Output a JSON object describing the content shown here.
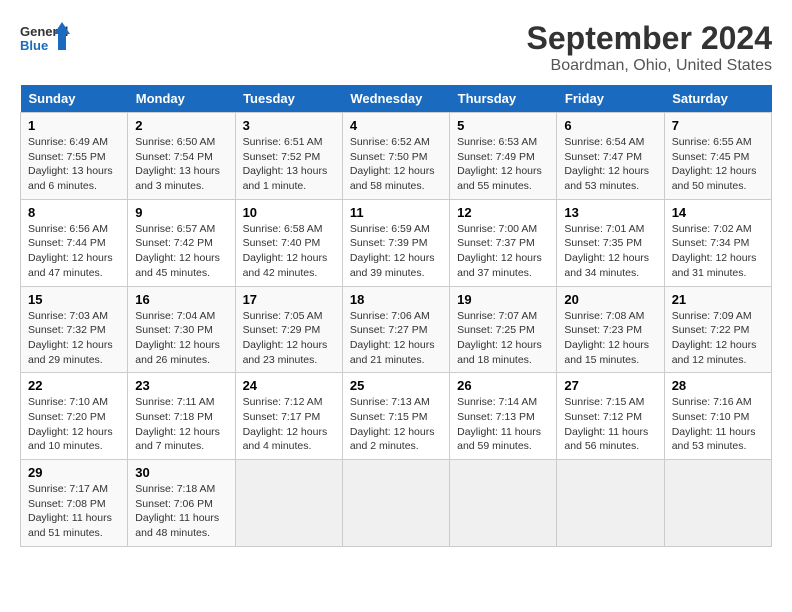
{
  "logo": {
    "line1": "General",
    "line2": "Blue"
  },
  "title": "September 2024",
  "subtitle": "Boardman, Ohio, United States",
  "header_days": [
    "Sunday",
    "Monday",
    "Tuesday",
    "Wednesday",
    "Thursday",
    "Friday",
    "Saturday"
  ],
  "weeks": [
    [
      {
        "day": "1",
        "info": "Sunrise: 6:49 AM\nSunset: 7:55 PM\nDaylight: 13 hours\nand 6 minutes."
      },
      {
        "day": "2",
        "info": "Sunrise: 6:50 AM\nSunset: 7:54 PM\nDaylight: 13 hours\nand 3 minutes."
      },
      {
        "day": "3",
        "info": "Sunrise: 6:51 AM\nSunset: 7:52 PM\nDaylight: 13 hours\nand 1 minute."
      },
      {
        "day": "4",
        "info": "Sunrise: 6:52 AM\nSunset: 7:50 PM\nDaylight: 12 hours\nand 58 minutes."
      },
      {
        "day": "5",
        "info": "Sunrise: 6:53 AM\nSunset: 7:49 PM\nDaylight: 12 hours\nand 55 minutes."
      },
      {
        "day": "6",
        "info": "Sunrise: 6:54 AM\nSunset: 7:47 PM\nDaylight: 12 hours\nand 53 minutes."
      },
      {
        "day": "7",
        "info": "Sunrise: 6:55 AM\nSunset: 7:45 PM\nDaylight: 12 hours\nand 50 minutes."
      }
    ],
    [
      {
        "day": "8",
        "info": "Sunrise: 6:56 AM\nSunset: 7:44 PM\nDaylight: 12 hours\nand 47 minutes."
      },
      {
        "day": "9",
        "info": "Sunrise: 6:57 AM\nSunset: 7:42 PM\nDaylight: 12 hours\nand 45 minutes."
      },
      {
        "day": "10",
        "info": "Sunrise: 6:58 AM\nSunset: 7:40 PM\nDaylight: 12 hours\nand 42 minutes."
      },
      {
        "day": "11",
        "info": "Sunrise: 6:59 AM\nSunset: 7:39 PM\nDaylight: 12 hours\nand 39 minutes."
      },
      {
        "day": "12",
        "info": "Sunrise: 7:00 AM\nSunset: 7:37 PM\nDaylight: 12 hours\nand 37 minutes."
      },
      {
        "day": "13",
        "info": "Sunrise: 7:01 AM\nSunset: 7:35 PM\nDaylight: 12 hours\nand 34 minutes."
      },
      {
        "day": "14",
        "info": "Sunrise: 7:02 AM\nSunset: 7:34 PM\nDaylight: 12 hours\nand 31 minutes."
      }
    ],
    [
      {
        "day": "15",
        "info": "Sunrise: 7:03 AM\nSunset: 7:32 PM\nDaylight: 12 hours\nand 29 minutes."
      },
      {
        "day": "16",
        "info": "Sunrise: 7:04 AM\nSunset: 7:30 PM\nDaylight: 12 hours\nand 26 minutes."
      },
      {
        "day": "17",
        "info": "Sunrise: 7:05 AM\nSunset: 7:29 PM\nDaylight: 12 hours\nand 23 minutes."
      },
      {
        "day": "18",
        "info": "Sunrise: 7:06 AM\nSunset: 7:27 PM\nDaylight: 12 hours\nand 21 minutes."
      },
      {
        "day": "19",
        "info": "Sunrise: 7:07 AM\nSunset: 7:25 PM\nDaylight: 12 hours\nand 18 minutes."
      },
      {
        "day": "20",
        "info": "Sunrise: 7:08 AM\nSunset: 7:23 PM\nDaylight: 12 hours\nand 15 minutes."
      },
      {
        "day": "21",
        "info": "Sunrise: 7:09 AM\nSunset: 7:22 PM\nDaylight: 12 hours\nand 12 minutes."
      }
    ],
    [
      {
        "day": "22",
        "info": "Sunrise: 7:10 AM\nSunset: 7:20 PM\nDaylight: 12 hours\nand 10 minutes."
      },
      {
        "day": "23",
        "info": "Sunrise: 7:11 AM\nSunset: 7:18 PM\nDaylight: 12 hours\nand 7 minutes."
      },
      {
        "day": "24",
        "info": "Sunrise: 7:12 AM\nSunset: 7:17 PM\nDaylight: 12 hours\nand 4 minutes."
      },
      {
        "day": "25",
        "info": "Sunrise: 7:13 AM\nSunset: 7:15 PM\nDaylight: 12 hours\nand 2 minutes."
      },
      {
        "day": "26",
        "info": "Sunrise: 7:14 AM\nSunset: 7:13 PM\nDaylight: 11 hours\nand 59 minutes."
      },
      {
        "day": "27",
        "info": "Sunrise: 7:15 AM\nSunset: 7:12 PM\nDaylight: 11 hours\nand 56 minutes."
      },
      {
        "day": "28",
        "info": "Sunrise: 7:16 AM\nSunset: 7:10 PM\nDaylight: 11 hours\nand 53 minutes."
      }
    ],
    [
      {
        "day": "29",
        "info": "Sunrise: 7:17 AM\nSunset: 7:08 PM\nDaylight: 11 hours\nand 51 minutes."
      },
      {
        "day": "30",
        "info": "Sunrise: 7:18 AM\nSunset: 7:06 PM\nDaylight: 11 hours\nand 48 minutes."
      },
      {
        "day": "",
        "info": ""
      },
      {
        "day": "",
        "info": ""
      },
      {
        "day": "",
        "info": ""
      },
      {
        "day": "",
        "info": ""
      },
      {
        "day": "",
        "info": ""
      }
    ]
  ]
}
